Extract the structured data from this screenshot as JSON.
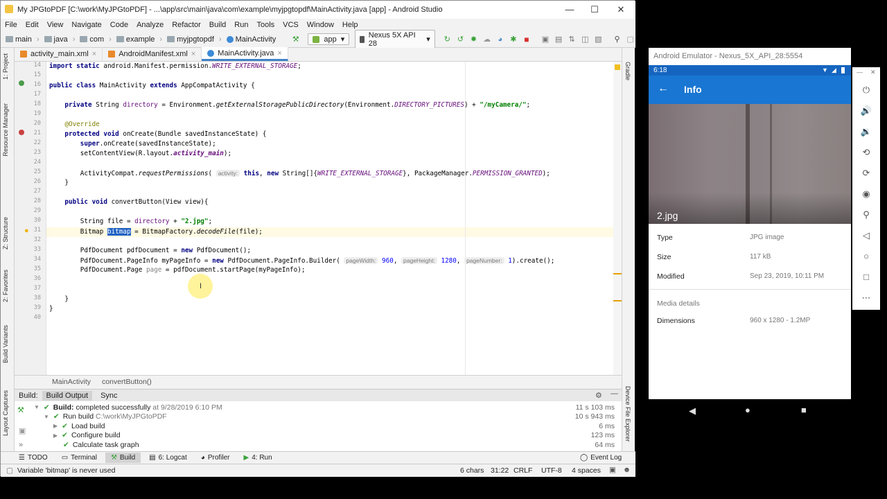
{
  "ide": {
    "title": "My JPGtoPDF [C:\\work\\MyJPGtoPDF] - ...\\app\\src\\main\\java\\com\\example\\myjpgtopdf\\MainActivity.java [app] - Android Studio",
    "menu": [
      "File",
      "Edit",
      "View",
      "Navigate",
      "Code",
      "Analyze",
      "Refactor",
      "Build",
      "Run",
      "Tools",
      "VCS",
      "Window",
      "Help"
    ],
    "breadcrumbs": [
      "main",
      "java",
      "com",
      "example",
      "myjpgtopdf",
      "MainActivity"
    ],
    "run_config": "app",
    "device": "Nexus 5X API 28",
    "tabs": [
      "activity_main.xml",
      "AndroidManifest.xml",
      "MainActivity.java"
    ],
    "left_panels": [
      "1: Project",
      "Resource Manager",
      "Z: Structure",
      "2: Favorites",
      "Build Variants",
      "Layout Captures"
    ],
    "right_panels": [
      "Gradle",
      "Device File Explorer"
    ],
    "line_numbers": [
      "14",
      "15",
      "16",
      "17",
      "18",
      "19",
      "20",
      "21",
      "22",
      "23",
      "24",
      "25",
      "26",
      "27",
      "28",
      "29",
      "30",
      "31",
      "32",
      "33",
      "34",
      "35",
      "36",
      "37",
      "38",
      "39",
      "40"
    ],
    "editor_breadcrumb": [
      "MainActivity",
      "convertButton()"
    ],
    "build": {
      "label": "Build:",
      "tabs": [
        "Build Output",
        "Sync"
      ],
      "rows": [
        {
          "bold": "Build:",
          "text": "completed successfully",
          "extra": "at 9/28/2019 6:10 PM",
          "time": "11 s 103 ms"
        },
        {
          "text": "Run build",
          "extra": "C:\\work\\MyJPGtoPDF",
          "time": "10 s 943 ms"
        },
        {
          "text": "Load build",
          "time": "6 ms"
        },
        {
          "text": "Configure build",
          "time": "123 ms"
        },
        {
          "text": "Calculate task graph",
          "time": "64 ms"
        }
      ]
    },
    "bottom_tabs": [
      "TODO",
      "Terminal",
      "Build",
      "6: Logcat",
      "Profiler",
      "4: Run"
    ],
    "event_log": "Event Log",
    "status": {
      "message": "Variable 'bitmap' is never used",
      "chars": "6 chars",
      "pos": "31:22",
      "crlf": "CRLF",
      "enc": "UTF-8",
      "indent": "4 spaces"
    }
  },
  "emulator": {
    "title": "Android Emulator - Nexus_5X_API_28:5554",
    "time": "6:18",
    "appbar_title": "Info",
    "photo_name": "2.jpg",
    "details": [
      {
        "label": "Type",
        "value": "JPG image"
      },
      {
        "label": "Size",
        "value": "117 kB"
      },
      {
        "label": "Modified",
        "value": "Sep 23, 2019, 10:11 PM"
      }
    ],
    "media_header": "Media details",
    "dimensions_label": "Dimensions",
    "dimensions_value": "960 x 1280 - 1.2MP"
  }
}
